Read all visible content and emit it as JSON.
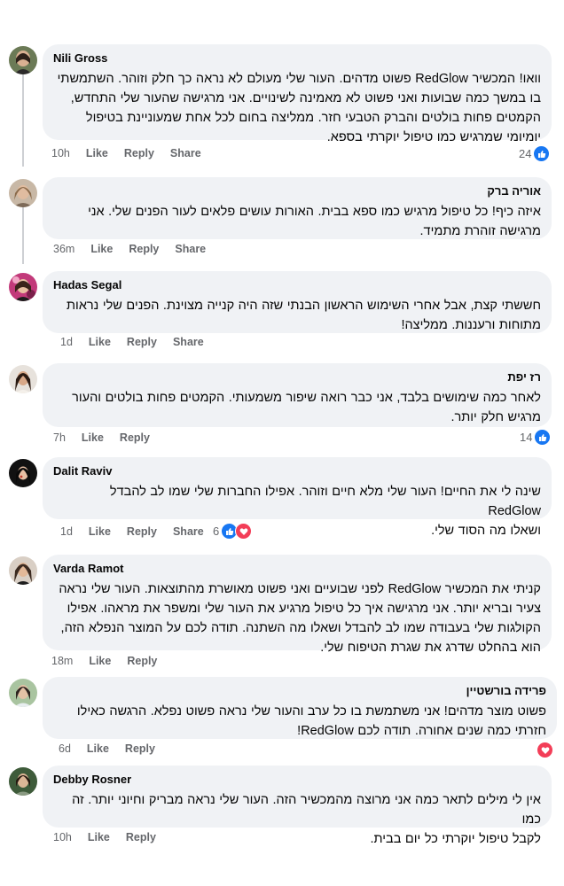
{
  "comments": [
    {
      "name": "Nili Gross",
      "name_rtl": false,
      "lines": [
        "וואו! המכשיר RedGlow פשוט מדהים. העור שלי מעולם לא נראה כך חלק וזוהר. השתמשתי",
        "בו במשך כמה שבועות ואני פשוט לא מאמינה לשינויים. אני מרגישה שהעור שלי התחדש,",
        "הקמטים פחות בולטים והברק הטבעי חזר. ממליצה בחום לכל אחת שמעוניינת בטיפול",
        "יומיומי שמרגיש כמו טיפול יוקרתי בספא."
      ],
      "time": "10h",
      "like": "Like",
      "reply": "Reply",
      "share": "Share",
      "reaction_count": "24",
      "reactions": [
        "like"
      ]
    },
    {
      "name": "אוריה ברק",
      "name_rtl": true,
      "lines": [
        "איזה כיף! כל טיפול מרגיש כמו ספא בבית. האורות עושים פלאים לעור הפנים שלי. אני",
        "מרגישה זוהרת מתמיד."
      ],
      "time": "36m",
      "like": "Like",
      "reply": "Reply",
      "share": "Share",
      "reaction_count": "",
      "reactions": []
    },
    {
      "name": "Hadas Segal",
      "name_rtl": false,
      "lines": [
        "חששתי קצת, אבל אחרי השימוש הראשון הבנתי שזה היה קנייה מצוינת. הפנים שלי נראות",
        "מתוחות ורעננות. ממליצה!"
      ],
      "time": "1d",
      "like": "Like",
      "reply": "Reply",
      "share": "Share",
      "reaction_count": "",
      "reactions": []
    },
    {
      "name": "רז יפת",
      "name_rtl": true,
      "lines": [
        "לאחר כמה שימושים בלבד, אני כבר רואה שיפור משמעותי. הקמטים פחות בולטים והעור",
        "מרגיש חלק יותר."
      ],
      "time": "7h",
      "like": "Like",
      "reply": "Reply",
      "share": "",
      "reaction_count": "14",
      "reactions": [
        "like"
      ]
    },
    {
      "name": "Dalit Raviv",
      "name_rtl": false,
      "lines": [
        "שינה לי את החיים! העור שלי מלא חיים וזוהר. אפילו החברות שלי שמו לב להבדל RedGlow",
        "ושאלו מה הסוד שלי."
      ],
      "time": "1d",
      "like": "Like",
      "reply": "Reply",
      "share": "Share",
      "reaction_count": "6",
      "reactions": [
        "like",
        "love"
      ]
    },
    {
      "name": "Varda Ramot",
      "name_rtl": false,
      "lines": [
        "קניתי את המכשיר RedGlow לפני שבועיים ואני פשוט מאושרת מהתוצאות. העור שלי נראה",
        "צעיר ובריא יותר. אני מרגישה איך כל טיפול מרגיע את העור שלי ומשפר את מראהו. אפילו",
        "הקולגות שלי בעבודה שמו לב להבדל ושאלו מה השתנה. תודה לכם על המוצר הנפלא הזה,",
        "הוא בהחלט שדרג את שגרת הטיפוח שלי."
      ],
      "time": "18m",
      "like": "Like",
      "reply": "Reply",
      "share": "",
      "reaction_count": "",
      "reactions": []
    },
    {
      "name": "פרידה בורשטיין",
      "name_rtl": true,
      "lines": [
        "פשוט מוצר מדהים! אני משתמשת בו כל ערב והעור שלי נראה פשוט נפלא. הרגשה כאילו",
        "חזרתי כמה שנים אחורה. תודה לכם RedGlow!"
      ],
      "time": "6d",
      "like": "Like",
      "reply": "Reply",
      "share": "",
      "reaction_count": "",
      "reactions": [
        "love"
      ]
    },
    {
      "name": "Debby Rosner",
      "name_rtl": false,
      "lines": [
        "אין לי מילים לתאר כמה אני מרוצה מהמכשיר הזה. העור שלי נראה מבריק וחיוני יותר. זה כמו",
        "לקבל טיפול יוקרתי כל יום בבית."
      ],
      "time": "10h",
      "like": "Like",
      "reply": "Reply",
      "share": "",
      "reaction_count": "",
      "reactions": []
    }
  ],
  "colors": {
    "bubble": "#f0f2f5",
    "meta": "#65676b",
    "like_blue": "#1877f2",
    "love_red": "#f33e58"
  }
}
